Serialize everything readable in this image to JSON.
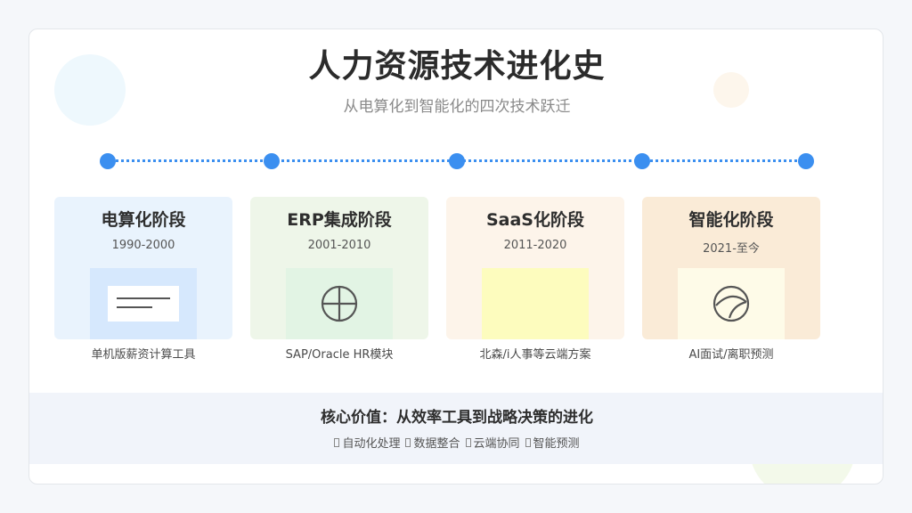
{
  "header": {
    "title": "人力资源技术进化史",
    "subtitle": "从电算化到智能化的四次技术跃迁"
  },
  "colors": {
    "timeline": "#3b8ff0",
    "stage_1_bg": "#e9f3fd",
    "stage_2_bg": "#eef6e9",
    "stage_3_bg": "#fdf4ea",
    "stage_4_bg": "#faebd7"
  },
  "stages": [
    {
      "title": "电算化阶段",
      "years": "1990-2000",
      "caption": "单机版薪资计算工具",
      "icon": "document-icon"
    },
    {
      "title": "ERP集成阶段",
      "years": "2001-2010",
      "caption": "SAP/Oracle HR模块",
      "icon": "crosshair-circle-icon"
    },
    {
      "title": "SaaS化阶段",
      "years": "2011-2020",
      "caption": "北森/i人事等云端方案",
      "icon": "cloud-box-icon"
    },
    {
      "title": "智能化阶段",
      "years": "2021-至今",
      "caption": "AI面试/离职预测",
      "icon": "gauge-icon"
    }
  ],
  "core_value": {
    "title": "核心价值：从效率工具到战略决策的进化",
    "items": [
      "自动化处理",
      "数据整合",
      "云端协同",
      "智能预测"
    ]
  }
}
